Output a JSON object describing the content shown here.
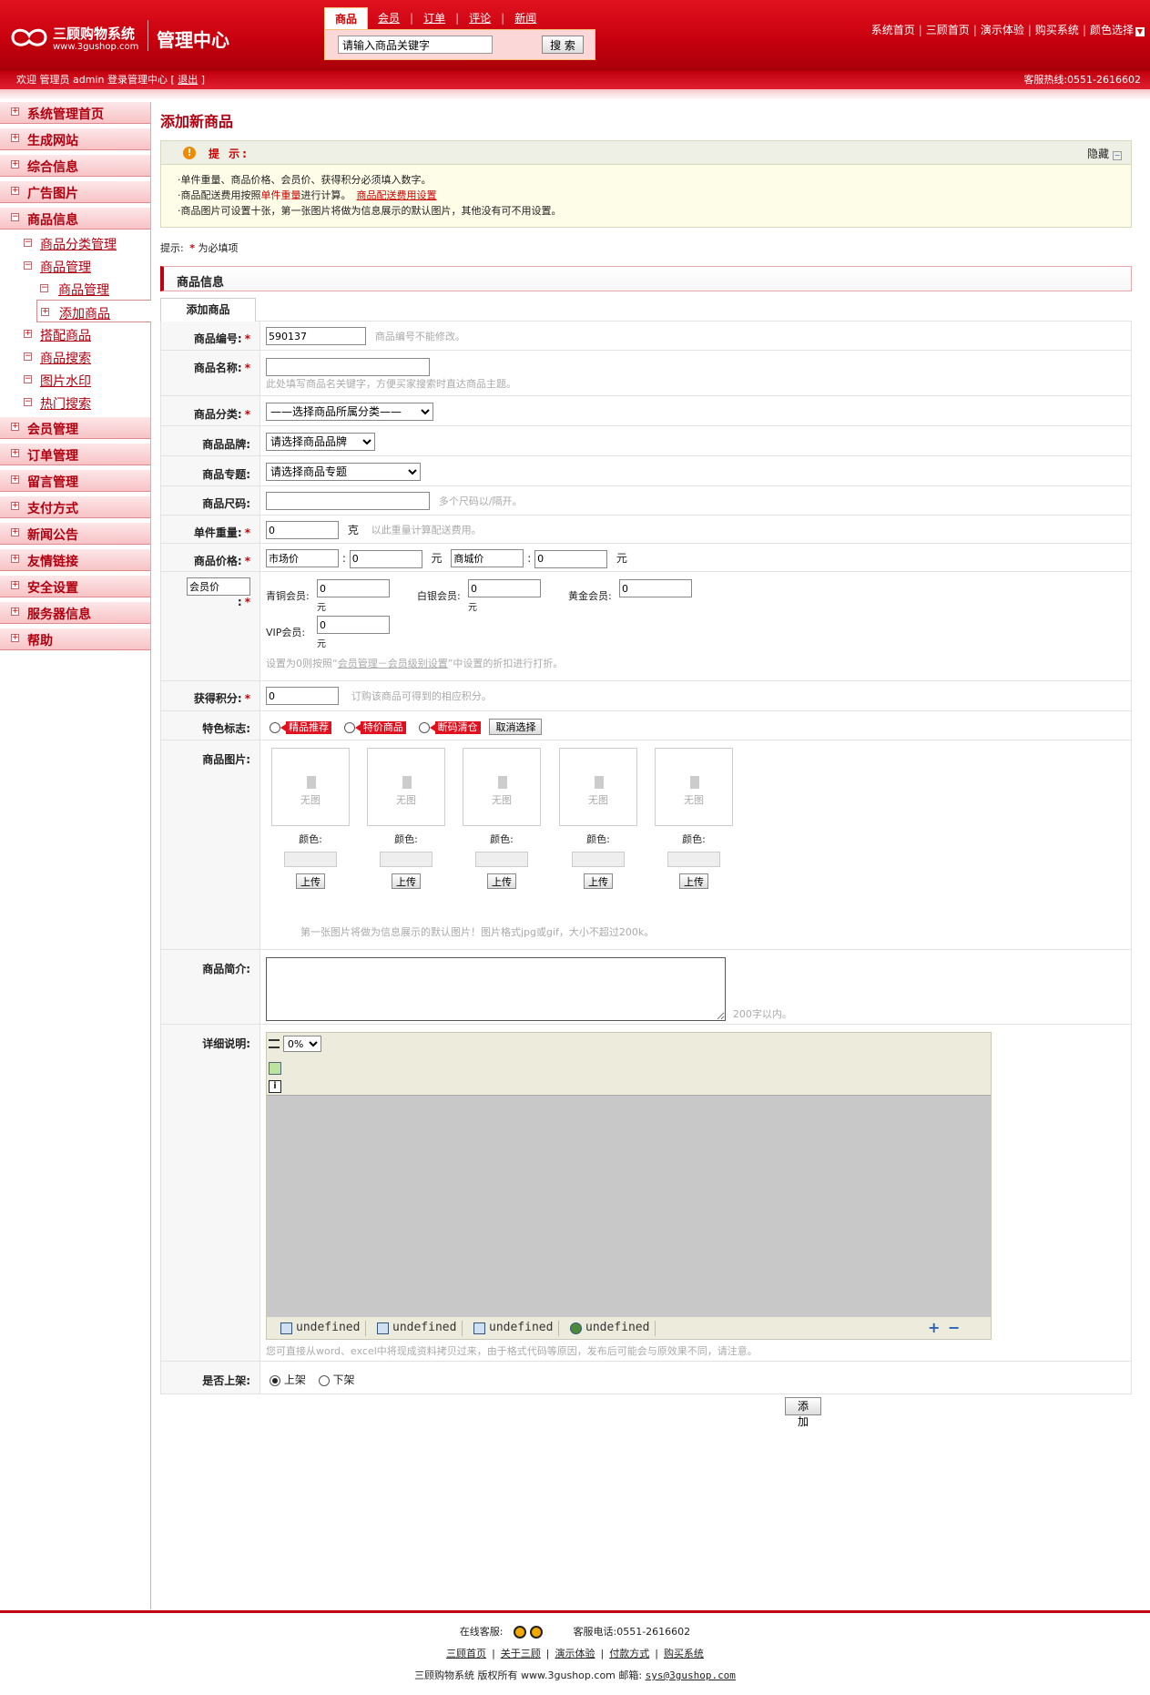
{
  "brand": {
    "name": "三顾购物系统",
    "url": "www.3gushop.com",
    "admin_title": "管理中心"
  },
  "search": {
    "tabs": [
      "商品",
      "会员",
      "订单",
      "评论",
      "新闻"
    ],
    "active_tab": "商品",
    "value": "请输入商品关键字",
    "button": "搜 索"
  },
  "top_links": [
    "系统首页",
    "三顾首页",
    "演示体验",
    "购买系统",
    "颜色选择"
  ],
  "welcome": {
    "text": "欢迎 管理员 admin 登录管理中心 [",
    "logout": "退出",
    "close": "]",
    "hotline": "客服热线:0551-2616602"
  },
  "sidebar": {
    "groups_top": [
      "系统管理首页",
      "生成网站",
      "综合信息",
      "广告图片",
      "商品信息"
    ],
    "sub_items": [
      {
        "label": "商品分类管理",
        "level": 1
      },
      {
        "label": "商品管理",
        "level": 1
      },
      {
        "label": "商品管理",
        "level": 2
      },
      {
        "label": "添加商品",
        "level": 2,
        "current": true
      },
      {
        "label": "搭配商品",
        "level": 1
      },
      {
        "label": "商品搜索",
        "level": 1
      },
      {
        "label": "图片水印",
        "level": 1
      },
      {
        "label": "热门搜索",
        "level": 1
      }
    ],
    "groups_bottom": [
      "会员管理",
      "订单管理",
      "留言管理",
      "支付方式",
      "新闻公告",
      "友情链接",
      "安全设置",
      "服务器信息",
      "帮助"
    ]
  },
  "page": {
    "title": "添加新商品",
    "tip_title": "提 示:",
    "tip_hide": "隐藏",
    "tip_line1": "·单件重量、商品价格、会员价、获得积分必须填入数字。",
    "tip_line2_a": "·商品配送费用按照",
    "tip_line2_red": "单件重量",
    "tip_line2_b": "进行计算。",
    "tip_line2_link": "商品配送费用设置",
    "tip_line3": "·商品图片可设置十张，第一张图片将做为信息展示的默认图片，其他没有可不用设置。",
    "required_note_a": "提示:",
    "required_note_b": "为必填项",
    "section_title": "商品信息",
    "form_tab": "添加商品"
  },
  "form": {
    "code_label": "商品编号:",
    "code_value": "590137",
    "code_hint": "商品编号不能修改。",
    "name_label": "商品名称:",
    "name_hint": "此处填写商品名关键字，方便买家搜索时直达商品主题。",
    "category_label": "商品分类:",
    "category_value": "——选择商品所属分类——",
    "brand_label": "商品品牌:",
    "brand_value": "请选择商品品牌",
    "topic_label": "商品专题:",
    "topic_value": "请选择商品专题",
    "size_label": "商品尺码:",
    "size_hint": "多个尺码以/隔开。",
    "weight_label": "单件重量:",
    "weight_value": "0",
    "weight_unit": "克",
    "weight_hint": "以此重量计算配送费用。",
    "price_label": "商品价格:",
    "market_label": "市场价",
    "market_value": "0",
    "shop_label": "商城价",
    "shop_value": "0",
    "yuan": "元",
    "colon": ":",
    "member_label_input": "会员价",
    "member_label_colon": ":",
    "members": [
      {
        "name": "青铜会员:",
        "value": "0"
      },
      {
        "name": "白银会员:",
        "value": "0"
      },
      {
        "name": "黄金会员:",
        "value": "0"
      },
      {
        "name": "VIP会员:",
        "value": "0"
      }
    ],
    "member_hint_a": "设置为0则按照“",
    "member_hint_link": "会员管理－会员级别设置",
    "member_hint_b": "”中设置的折扣进行打折。",
    "points_label": "获得积分:",
    "points_value": "0",
    "points_hint": "订购该商品可得到的相应积分。",
    "feature_label": "特色标志:",
    "features": [
      "精品推荐",
      "特价商品",
      "断码清仓"
    ],
    "feature_cancel": "取消选择",
    "image_label": "商品图片:",
    "image_placeholder": "无图",
    "image_color": "颜色:",
    "image_upload": "上传",
    "image_hint": "第一张图片将做为信息展示的默认图片！图片格式jpg或gif，大小不超过200k。",
    "intro_label": "商品简介:",
    "intro_hint": "200字以内。",
    "detail_label": "详细说明:",
    "editor_zoom": "0%",
    "editor_modes": [
      "undefined",
      "undefined",
      "undefined",
      "undefined"
    ],
    "editor_hint": "您可直接从word、excel中将现成资料拷贝过来，由于格式代码等原因，发布后可能会与原效果不同，请注意。",
    "onsale_label": "是否上架:",
    "onsale_yes": "上架",
    "onsale_no": "下架",
    "submit": "添 加"
  },
  "footer": {
    "online": "在线客服:",
    "phone": "客服电话:0551-2616602",
    "links": [
      "三顾首页",
      "关于三顾",
      "演示体验",
      "付款方式",
      "购买系统"
    ],
    "copyright": "三顾购物系统 版权所有 www.3gushop.com 邮箱:",
    "email": "sys@3gushop.com"
  },
  "colors": {
    "brand_red": "#c8000e",
    "accent": "#b00010"
  }
}
